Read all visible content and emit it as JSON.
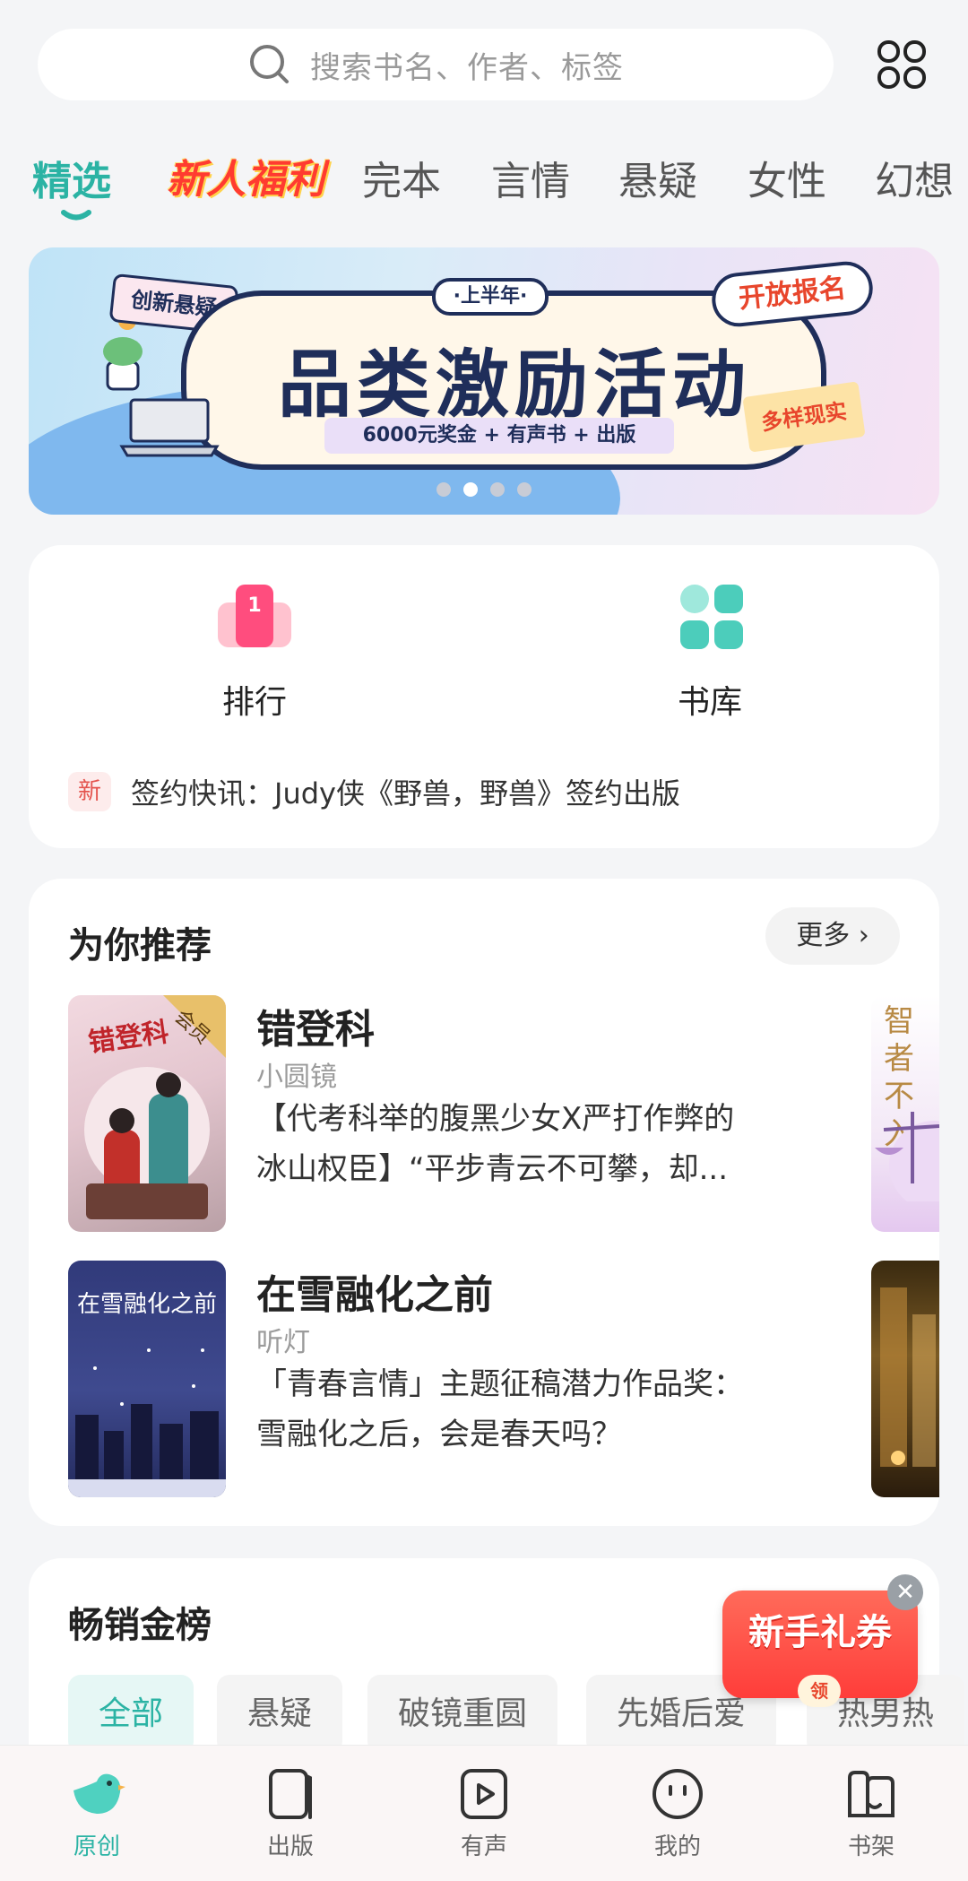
{
  "search": {
    "placeholder": "搜索书名、作者、标签"
  },
  "tabs": [
    {
      "label": "精选",
      "active": true
    },
    {
      "label": "新人福利",
      "promo": true
    },
    {
      "label": "完本"
    },
    {
      "label": "言情"
    },
    {
      "label": "悬疑"
    },
    {
      "label": "女性"
    },
    {
      "label": "幻想"
    }
  ],
  "banner": {
    "pill": "·上半年·",
    "headline": "品类激励活动",
    "subline": "6000元奖金 + 有声书 + 出版",
    "tag_left": "创新悬疑",
    "tag_right": "开放报名",
    "tag_bottom": "多样现实",
    "slide_count": 4,
    "active_slide": 2
  },
  "quick": {
    "ranking_label": "排行",
    "ranking_badge": "1",
    "library_label": "书库",
    "news_badge": "新",
    "news_text": "签约快讯：Judy侠《野兽，野兽》签约出版"
  },
  "recommend": {
    "title": "为你推荐",
    "more": "更多",
    "books": [
      {
        "title": "错登科",
        "author": "小圆镜",
        "desc1": "【代考科举的腹黑少女X严打作弊的",
        "desc2": "冰山权臣】“平步青云不可攀，却...",
        "cover_text": "错登科",
        "cover_badge": "会员"
      },
      {
        "title": "在雪融化之前",
        "author": "听灯",
        "desc1": "「青春言情」主题征稿潜力作品奖：",
        "desc2": "雪融化之后，会是春天吗？",
        "cover_text": "在雪融化之前"
      }
    ],
    "peek_text": "智者不入"
  },
  "bestseller": {
    "title": "畅销金榜",
    "chips": [
      "全部",
      "悬疑",
      "破镜重圆",
      "先婚后爱",
      "热男热"
    ]
  },
  "coupon": {
    "label": "新手礼券",
    "get": "领",
    "close": "✕"
  },
  "nav": [
    {
      "label": "原创",
      "icon": "bird-icon",
      "active": true
    },
    {
      "label": "出版",
      "icon": "book-icon"
    },
    {
      "label": "有声",
      "icon": "play-icon"
    },
    {
      "label": "我的",
      "icon": "face-icon"
    },
    {
      "label": "书架",
      "icon": "shelf-icon"
    }
  ],
  "colors": {
    "accent": "#2bb3a4",
    "promo": "#ff3b30",
    "navy": "#1f2e5a"
  }
}
